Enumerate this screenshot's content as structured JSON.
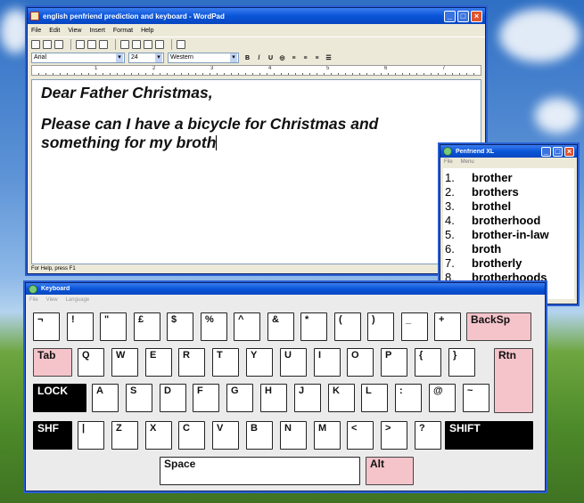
{
  "wordpad": {
    "title": "english penfriend prediction and keyboard - WordPad",
    "menu": [
      "File",
      "Edit",
      "View",
      "Insert",
      "Format",
      "Help"
    ],
    "font_name": "Arial",
    "font_size": "24",
    "script": "Western",
    "format_buttons": [
      "B",
      "/",
      "U",
      "◎",
      "≡",
      "≡",
      "≡",
      "☰"
    ],
    "ruler_labels": [
      "1",
      "2",
      "3",
      "4",
      "5",
      "6",
      "7"
    ],
    "document": {
      "line1": "Dear Father Christmas,",
      "line2": "Please can I have a bicycle for Christmas and",
      "line3": "something for my broth"
    },
    "status": "For Help, press F1"
  },
  "penfriend": {
    "title": "Penfriend XL",
    "menu": [
      "File",
      "Menu"
    ],
    "predictions": [
      {
        "num": "1.",
        "word": "brother"
      },
      {
        "num": "2.",
        "word": "brothers"
      },
      {
        "num": "3.",
        "word": "brothel"
      },
      {
        "num": "4.",
        "word": "brotherhood"
      },
      {
        "num": "5.",
        "word": "brother-in-law"
      },
      {
        "num": "6.",
        "word": "broth"
      },
      {
        "num": "7.",
        "word": "brotherly"
      },
      {
        "num": "8.",
        "word": "brotherhoods"
      }
    ]
  },
  "keyboard": {
    "title": "Keyboard",
    "menu": [
      "File",
      "View",
      "Language"
    ],
    "row1": [
      "¬",
      "!",
      "\"",
      "£",
      "$",
      "%",
      "^",
      "&",
      "*",
      "(",
      ")",
      "_",
      "+"
    ],
    "backsp": "BackSp",
    "tab": "Tab",
    "row2": [
      "Q",
      "W",
      "E",
      "R",
      "T",
      "Y",
      "U",
      "I",
      "O",
      "P",
      "{",
      "}"
    ],
    "rtn": "Rtn",
    "lock": "LOCK",
    "row3": [
      "A",
      "S",
      "D",
      "F",
      "G",
      "H",
      "J",
      "K",
      "L",
      ":",
      "@",
      "~"
    ],
    "shf": "SHF",
    "row4": [
      "|",
      "Z",
      "X",
      "C",
      "V",
      "B",
      "N",
      "M",
      "<",
      ">",
      "?"
    ],
    "shift": "SHIFT",
    "space": "Space",
    "alt": "Alt"
  }
}
